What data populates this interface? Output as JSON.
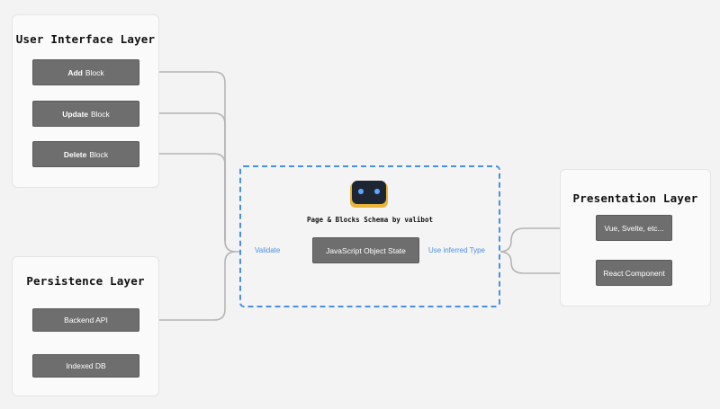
{
  "ui_layer": {
    "title": "User Interface Layer",
    "nodes": [
      {
        "bold": "Add",
        "rest": "Block"
      },
      {
        "bold": "Update",
        "rest": "Block"
      },
      {
        "bold": "Delete",
        "rest": "Block"
      }
    ]
  },
  "persistence_layer": {
    "title": "Persistence Layer",
    "nodes": [
      "Backend API",
      "Indexed DB"
    ]
  },
  "presentation_layer": {
    "title": "Presentation Layer",
    "nodes": [
      "Vue, Svelte, etc...",
      "React Component"
    ]
  },
  "schema": {
    "title": "Page & Blocks Schema by valibot",
    "state_node": "JavaScript Object State",
    "validate_label": "Validate",
    "inferred_label": "Use inferred Type",
    "logo_icon": "robot-icon"
  },
  "colors": {
    "accent": "#4a90e2",
    "node_fill": "#6e6e6e",
    "wire": "#b5b5b5",
    "robot_body": "#1e2633",
    "robot_frame": "#e8b53a",
    "robot_eye": "#5fa8ff"
  }
}
